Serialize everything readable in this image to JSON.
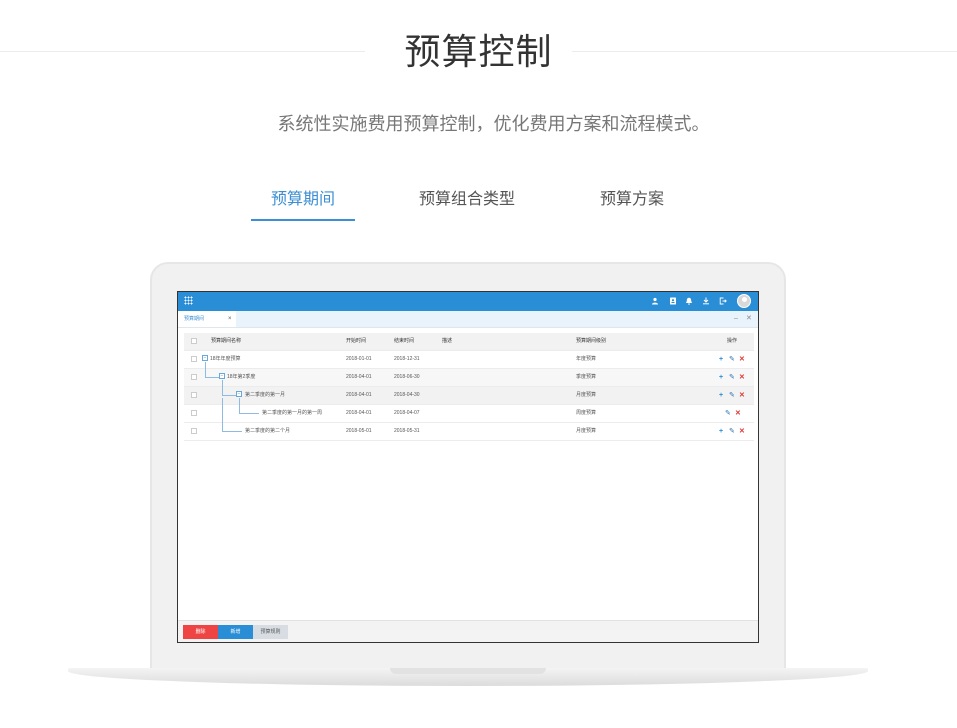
{
  "hero": {
    "title": "预算控制",
    "subtitle": "系统性实施费用预算控制，优化费用方案和流程模式。",
    "tabs": [
      {
        "label": "预算期间",
        "active": true
      },
      {
        "label": "预算组合类型",
        "active": false
      },
      {
        "label": "预算方案",
        "active": false
      }
    ]
  },
  "colors": {
    "accent": "#2a8ed6",
    "delete": "#ef4444",
    "new": "#2a8ed6"
  },
  "app": {
    "toolbar_icons": [
      "grid-menu-icon",
      "user-icon",
      "contacts-icon",
      "bell-icon",
      "download-icon",
      "logout-icon",
      "avatar"
    ],
    "doc_tab": {
      "label": "预算期间",
      "close": "×"
    },
    "window_buttons": {
      "minimize": "–",
      "close": "✕"
    },
    "table": {
      "headers": {
        "name": "预算期间名称",
        "start": "开始时间",
        "end": "结束时间",
        "desc": "描述",
        "level": "预算期间级别",
        "ops": "操作"
      },
      "rows": [
        {
          "name": "18年年度预算",
          "start": "2018-01-01",
          "end": "2018-12-31",
          "desc": "",
          "level": "年度预算"
        },
        {
          "name": "18年第2季度",
          "start": "2018-04-01",
          "end": "2018-06-30",
          "desc": "",
          "level": "季度预算"
        },
        {
          "name": "第二季度的第一月",
          "start": "2018-04-01",
          "end": "2018-04-30",
          "desc": "",
          "level": "月度预算"
        },
        {
          "name": "第二季度的第一月的第一周",
          "start": "2018-04-01",
          "end": "2018-04-07",
          "desc": "",
          "level": "周度预算"
        },
        {
          "name": "第二季度的第二个月",
          "start": "2018-05-01",
          "end": "2018-05-31",
          "desc": "",
          "level": "月度预算"
        }
      ],
      "toggle_symbol": "−",
      "actions": {
        "add": "+",
        "edit": "✎",
        "delete": "✕"
      }
    },
    "footer": {
      "delete_label": "删除",
      "new_label": "新增",
      "rule_label": "预算规则"
    }
  }
}
